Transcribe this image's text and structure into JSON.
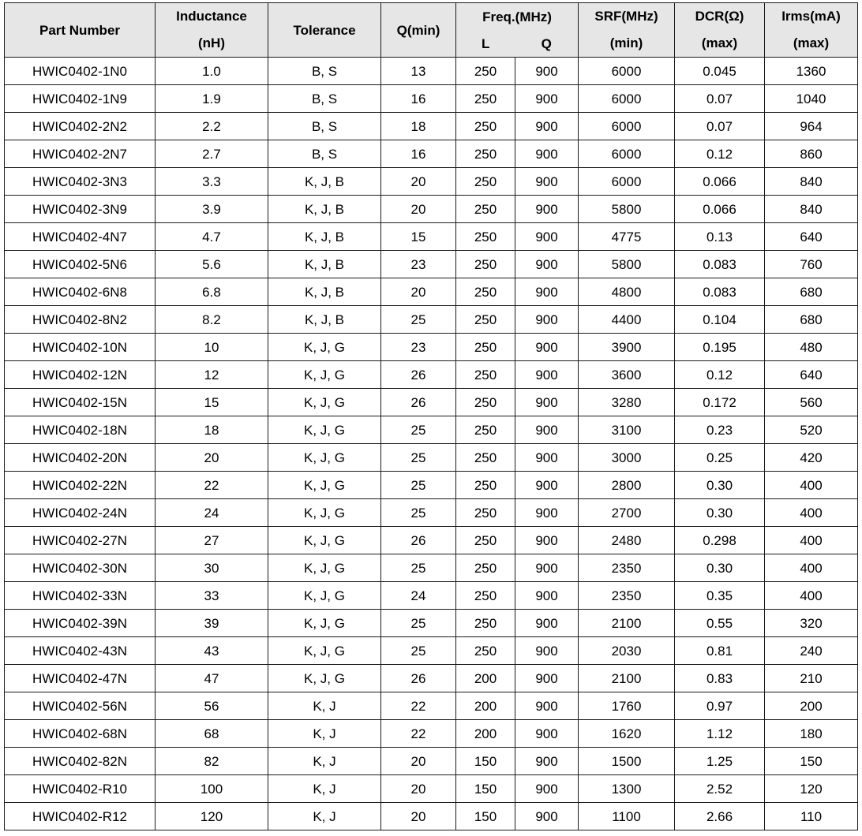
{
  "table": {
    "headers": {
      "part_number": "Part Number",
      "inductance": "Inductance",
      "inductance_unit": "(nH)",
      "tolerance": "Tolerance",
      "q_min": "Q(min)",
      "freq": "Freq.(MHz)",
      "freq_l": "L",
      "freq_q": "Q",
      "srf": "SRF(MHz)",
      "srf_unit": "(min)",
      "dcr": "DCR(Ω)",
      "dcr_unit": "(max)",
      "irms": "Irms(mA)",
      "irms_unit": "(max)"
    },
    "rows": [
      [
        "HWIC0402-1N0",
        "1.0",
        "B, S",
        "13",
        "250",
        "900",
        "6000",
        "0.045",
        "1360"
      ],
      [
        "HWIC0402-1N9",
        "1.9",
        "B, S",
        "16",
        "250",
        "900",
        "6000",
        "0.07",
        "1040"
      ],
      [
        "HWIC0402-2N2",
        "2.2",
        "B, S",
        "18",
        "250",
        "900",
        "6000",
        "0.07",
        "964"
      ],
      [
        "HWIC0402-2N7",
        "2.7",
        "B, S",
        "16",
        "250",
        "900",
        "6000",
        "0.12",
        "860"
      ],
      [
        "HWIC0402-3N3",
        "3.3",
        "K, J, B",
        "20",
        "250",
        "900",
        "6000",
        "0.066",
        "840"
      ],
      [
        "HWIC0402-3N9",
        "3.9",
        "K, J, B",
        "20",
        "250",
        "900",
        "5800",
        "0.066",
        "840"
      ],
      [
        "HWIC0402-4N7",
        "4.7",
        "K, J, B",
        "15",
        "250",
        "900",
        "4775",
        "0.13",
        "640"
      ],
      [
        "HWIC0402-5N6",
        "5.6",
        "K, J, B",
        "23",
        "250",
        "900",
        "5800",
        "0.083",
        "760"
      ],
      [
        "HWIC0402-6N8",
        "6.8",
        "K, J, B",
        "20",
        "250",
        "900",
        "4800",
        "0.083",
        "680"
      ],
      [
        "HWIC0402-8N2",
        "8.2",
        "K, J, B",
        "25",
        "250",
        "900",
        "4400",
        "0.104",
        "680"
      ],
      [
        "HWIC0402-10N",
        "10",
        "K, J, G",
        "23",
        "250",
        "900",
        "3900",
        "0.195",
        "480"
      ],
      [
        "HWIC0402-12N",
        "12",
        "K, J, G",
        "26",
        "250",
        "900",
        "3600",
        "0.12",
        "640"
      ],
      [
        "HWIC0402-15N",
        "15",
        "K, J, G",
        "26",
        "250",
        "900",
        "3280",
        "0.172",
        "560"
      ],
      [
        "HWIC0402-18N",
        "18",
        "K, J, G",
        "25",
        "250",
        "900",
        "3100",
        "0.23",
        "520"
      ],
      [
        "HWIC0402-20N",
        "20",
        "K, J, G",
        "25",
        "250",
        "900",
        "3000",
        "0.25",
        "420"
      ],
      [
        "HWIC0402-22N",
        "22",
        "K, J, G",
        "25",
        "250",
        "900",
        "2800",
        "0.30",
        "400"
      ],
      [
        "HWIC0402-24N",
        "24",
        "K, J, G",
        "25",
        "250",
        "900",
        "2700",
        "0.30",
        "400"
      ],
      [
        "HWIC0402-27N",
        "27",
        "K, J, G",
        "26",
        "250",
        "900",
        "2480",
        "0.298",
        "400"
      ],
      [
        "HWIC0402-30N",
        "30",
        "K, J, G",
        "25",
        "250",
        "900",
        "2350",
        "0.30",
        "400"
      ],
      [
        "HWIC0402-33N",
        "33",
        "K, J, G",
        "24",
        "250",
        "900",
        "2350",
        "0.35",
        "400"
      ],
      [
        "HWIC0402-39N",
        "39",
        "K, J, G",
        "25",
        "250",
        "900",
        "2100",
        "0.55",
        "320"
      ],
      [
        "HWIC0402-43N",
        "43",
        "K, J, G",
        "25",
        "250",
        "900",
        "2030",
        "0.81",
        "240"
      ],
      [
        "HWIC0402-47N",
        "47",
        "K, J, G",
        "26",
        "200",
        "900",
        "2100",
        "0.83",
        "210"
      ],
      [
        "HWIC0402-56N",
        "56",
        "K, J",
        "22",
        "200",
        "900",
        "1760",
        "0.97",
        "200"
      ],
      [
        "HWIC0402-68N",
        "68",
        "K, J",
        "22",
        "200",
        "900",
        "1620",
        "1.12",
        "180"
      ],
      [
        "HWIC0402-82N",
        "82",
        "K, J",
        "20",
        "150",
        "900",
        "1500",
        "1.25",
        "150"
      ],
      [
        "HWIC0402-R10",
        "100",
        "K, J",
        "20",
        "150",
        "900",
        "1300",
        "2.52",
        "120"
      ],
      [
        "HWIC0402-R12",
        "120",
        "K, J",
        "20",
        "150",
        "900",
        "1100",
        "2.66",
        "110"
      ]
    ],
    "colors": {
      "header_bg": "#e6e6e6",
      "border": "#1a1a1a"
    }
  }
}
